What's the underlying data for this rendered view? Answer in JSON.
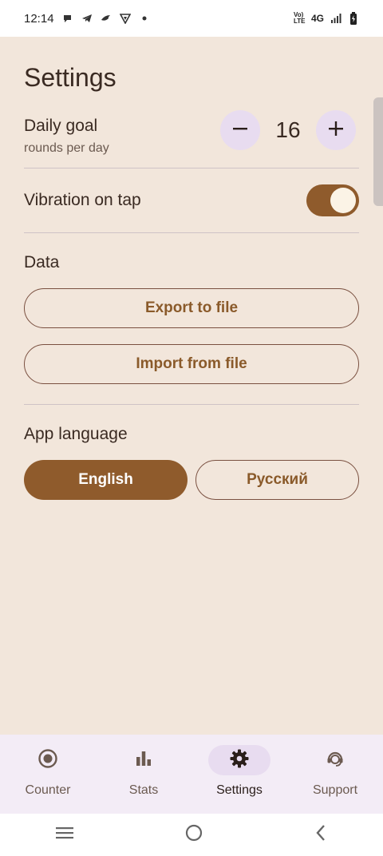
{
  "status_bar": {
    "time": "12:14",
    "left_icons": [
      "chat-bubble-icon",
      "telegram-icon",
      "bird-icon",
      "vpn-shield-icon",
      "dot-icon"
    ],
    "network": "4G",
    "volte": "Vo) LTE"
  },
  "page": {
    "title": "Settings"
  },
  "daily_goal": {
    "title": "Daily goal",
    "subtitle": "rounds per day",
    "value": "16",
    "decrement_icon": "minus-icon",
    "increment_icon": "plus-icon"
  },
  "vibration": {
    "label": "Vibration on tap",
    "enabled": true
  },
  "data_section": {
    "title": "Data",
    "export_label": "Export to file",
    "import_label": "Import from file"
  },
  "language_section": {
    "title": "App language",
    "options": [
      "English",
      "Русский"
    ],
    "selected": "English"
  },
  "bottom_nav": {
    "items": [
      {
        "label": "Counter",
        "icon": "record-circle-icon",
        "active": false
      },
      {
        "label": "Stats",
        "icon": "bar-chart-icon",
        "active": false
      },
      {
        "label": "Settings",
        "icon": "gear-icon",
        "active": true
      },
      {
        "label": "Support",
        "icon": "support-agent-icon",
        "active": false
      }
    ]
  },
  "system_nav": {
    "icons": [
      "menu-icon",
      "home-icon",
      "back-icon"
    ]
  },
  "colors": {
    "background": "#f2e6db",
    "accent": "#8f5b2c",
    "stepper_bg": "#e8dcf0",
    "nav_bg": "#f3ecf6"
  }
}
